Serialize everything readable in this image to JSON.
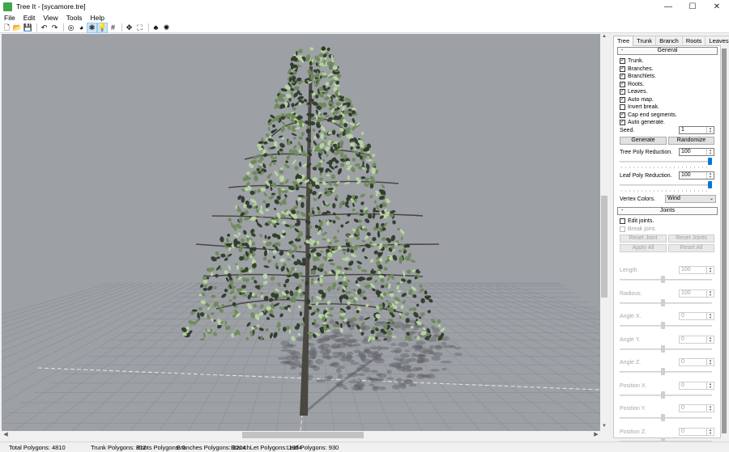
{
  "window": {
    "title": "Tree It - [sycamore.tre]",
    "minimize_glyph": "—",
    "maximize_glyph": "☐",
    "close_glyph": "✕"
  },
  "menu": [
    "File",
    "Edit",
    "View",
    "Tools",
    "Help"
  ],
  "toolbar": {
    "buttons": [
      {
        "name": "new-file-icon",
        "glyph": "🗋"
      },
      {
        "name": "open-folder-icon",
        "glyph": "📂"
      },
      {
        "name": "save-icon",
        "glyph": "💾"
      },
      {
        "name": "undo-icon",
        "glyph": "↶"
      },
      {
        "name": "redo-icon",
        "glyph": "↷"
      },
      {
        "name": "wireframe-icon",
        "glyph": "◎"
      },
      {
        "name": "color-wheel-icon",
        "glyph": "◕"
      },
      {
        "name": "leaf-render-icon",
        "glyph": "❃"
      },
      {
        "name": "light-bulb-icon",
        "glyph": "💡"
      },
      {
        "name": "grid-icon",
        "glyph": "#"
      },
      {
        "name": "move-icon",
        "glyph": "✥"
      },
      {
        "name": "fit-view-icon",
        "glyph": "⛶"
      },
      {
        "name": "tree-wizard-icon",
        "glyph": "♣"
      },
      {
        "name": "sun-settings-icon",
        "glyph": "✺"
      }
    ],
    "active": [
      7,
      8
    ]
  },
  "panel": {
    "tabs": [
      "Tree",
      "Trunk",
      "Branch",
      "Roots",
      "Leaves"
    ],
    "active_tab": "Tree",
    "general": {
      "header": "General",
      "collapse_glyph": "-",
      "checkboxes": [
        {
          "label": "Trunk.",
          "checked": true
        },
        {
          "label": "Branches.",
          "checked": true
        },
        {
          "label": "Branchlets.",
          "checked": true
        },
        {
          "label": "Roots.",
          "checked": true
        },
        {
          "label": "Leaves.",
          "checked": true
        },
        {
          "label": "Auto map.",
          "checked": true
        },
        {
          "label": "Invert break.",
          "checked": false
        },
        {
          "label": "Cap end segments.",
          "checked": true
        },
        {
          "label": "Auto generate.",
          "checked": true
        }
      ],
      "seed_label": "Seed.",
      "seed_value": "1",
      "generate_label": "Generate",
      "randomize_label": "Randomize",
      "tree_poly_label": "Tree Poly Reduction.",
      "tree_poly_value": "100",
      "tree_poly_fraction": 1.0,
      "leaf_poly_label": "Leaf Poly Reduction.",
      "leaf_poly_value": "100",
      "leaf_poly_fraction": 1.0,
      "vertex_colors_label": "Vertex Colors.",
      "vertex_colors_value": "Wind"
    },
    "joints": {
      "header": "Joints",
      "collapse_glyph": "-",
      "edit_joints_label": "Edit joints.",
      "break_joint_label": "Break joint.",
      "reset_joint_label": "Reset Joint",
      "reset_joints_label": "Reset Joints",
      "apply_all_label": "Apply All",
      "reset_all_label": "Reset All",
      "fields": [
        {
          "label": "Length.",
          "value": "100"
        },
        {
          "label": "Radious.",
          "value": "100"
        },
        {
          "label": "Angle X.",
          "value": "0"
        },
        {
          "label": "Angle Y.",
          "value": "0"
        },
        {
          "label": "Angle Z.",
          "value": "0"
        },
        {
          "label": "Position X.",
          "value": "0"
        },
        {
          "label": "Position Y.",
          "value": "0"
        },
        {
          "label": "Position Z.",
          "value": "0"
        }
      ]
    }
  },
  "status": {
    "total": "Total Polygons: 4810",
    "trunk": "Trunk Polygons: 312",
    "roots": "Roots Polygons: 0",
    "branches": "Branches Polygons: 2214",
    "branchlet": "BranchLet Polygons: 1354",
    "leaf": "Leaf Polygons: 930"
  },
  "colors": {
    "viewport_bg": "#9da1a6",
    "grid_line": "#8d9196",
    "foliage_dark": "#2f3a2a",
    "foliage_mid": "#6f8a5a",
    "foliage_light": "#b8d8a0",
    "trunk": "#4a4742",
    "accent": "#0078d7"
  }
}
